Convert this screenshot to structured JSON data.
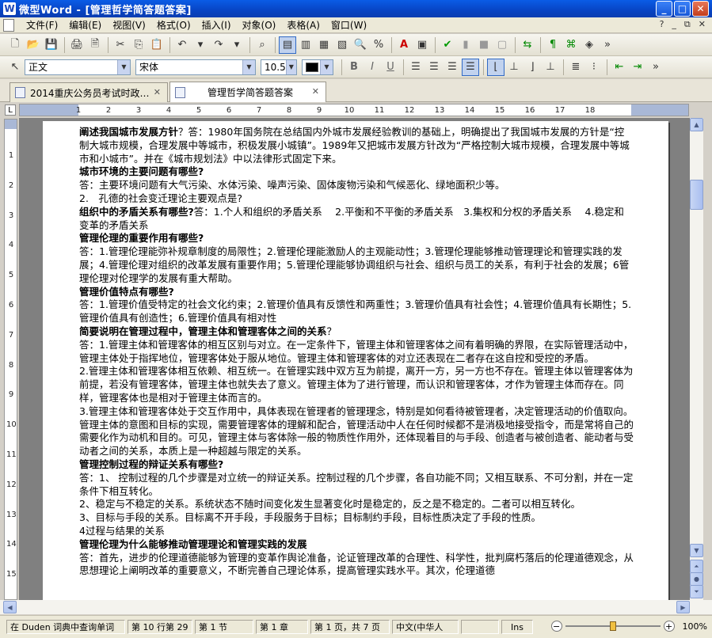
{
  "window": {
    "app_icon": "W",
    "title": "微型Word - [管理哲学简答题答案]",
    "controls": [
      "_",
      "□",
      "✕"
    ]
  },
  "menu": {
    "items": [
      "文件(F)",
      "编辑(E)",
      "视图(V)",
      "格式(O)",
      "插入(I)",
      "对象(O)",
      "表格(A)",
      "窗口(W)"
    ],
    "right_controls": [
      "?",
      "_",
      "⧉",
      "✕"
    ]
  },
  "toolbar2": {
    "style": "正文",
    "font": "宋体",
    "size": "10.5"
  },
  "tabs": [
    {
      "label": "2014重庆公务员考试时政…"
    },
    {
      "label": "管理哲学简答题答案"
    }
  ],
  "ruler": {
    "ticks": [
      "1",
      "2",
      "3",
      "4",
      "5",
      "6",
      "7",
      "8",
      "9",
      "10",
      "11",
      "12",
      "13",
      "14",
      "15",
      "16",
      "17",
      "18"
    ]
  },
  "vruler": {
    "ticks": [
      "1",
      "2",
      "3",
      "4",
      "5",
      "6",
      "7",
      "8",
      "9",
      "10",
      "11",
      "12",
      "13",
      "14",
      "15",
      "16"
    ]
  },
  "document": {
    "paragraphs": [
      {
        "bold": "阐述我国城市发展方针",
        "text": "？答：1980年国务院在总结国内外城市发展经验教训的基础上，明确提出了我国城市发展的方针是“控制大城市规模，合理发展中等城市，积极发展小城镇”。1989年又把城市发展方针改为“严格控制大城市规模，合理发展中等城市和小城市”。并在《城市规划法》中以法律形式固定下来。"
      },
      {
        "bold": "城市环境的主要问题有哪些?",
        "text": ""
      },
      {
        "bold": "",
        "text": "答：主要环境问题有大气污染、水体污染、噪声污染、固体废物污染和气候恶化、绿地面积少等。"
      },
      {
        "bold": "",
        "text": "2.　孔德的社会变迁理论主要观点是?"
      },
      {
        "bold": "组织中的矛盾关系有哪些?",
        "text": "答：1.个人和组织的矛盾关系　 2.平衡和不平衡的矛盾关系　3.集权和分权的矛盾关系　 4.稳定和变革的矛盾关系"
      },
      {
        "bold": "管理伦理的重要作用有哪些?",
        "text": ""
      },
      {
        "bold": "",
        "text": "答：1.管理伦理能弥补规章制度的局限性；2.管理伦理能激励人的主观能动性；3.管理伦理能够推动管理理论和管理实践的发展；4.管理伦理对组织的改革发展有重要作用；5.管理伦理能够协调组织与社会、组织与员工的关系，有利于社会的发展；6管理伦理对伦理学的发展有重大帮助。"
      },
      {
        "bold": "管理价值特点有哪些?",
        "text": ""
      },
      {
        "bold": "",
        "text": "答：1.管理价值受特定的社会文化约束；2.管理价值具有反馈性和两重性；3.管理价值具有社会性；4.管理价值具有长期性；5.管理价值具有创造性；6.管理价值具有相对性"
      },
      {
        "bold": "简要说明在管理过程中，管理主体和管理客体之间的关系",
        "text": "？"
      },
      {
        "bold": "",
        "text": "答：1.管理主体和管理客体的相互区别与对立。在一定条件下，管理主体和管理客体之间有着明确的界限，在实际管理活动中，管理主体处于指挥地位，管理客体处于服从地位。管理主体和管理客体的对立还表现在二者存在这自控和受控的矛盾。"
      },
      {
        "bold": "",
        "text": "2.管理主体和管理客体相互依赖、相互统一。在管理实践中双方互为前提，离开一方，另一方也不存在。管理主体以管理客体为前提，若没有管理客体，管理主体也就失去了意义。管理主体为了进行管理，而认识和管理客体，才作为管理主体而存在。同样，管理客体也是相对于管理主体而言的。"
      },
      {
        "bold": "",
        "text": "3.管理主体和管理客体处于交互作用中，具体表现在管理者的管理理念，特别是如何看待被管理者，决定管理活动的价值取向。管理主体的意图和目标的实现，需要管理客体的理解和配合，管理活动中人在任何时候都不是消极地接受指令，而是常将自己的需要化作为动机和目的。可见，管理主体与客体除一般的物质性作用外，还体现着目的与手段、创造者与被创造者、能动者与受动者之间的关系，本质上是一种超越与限定的关系。"
      },
      {
        "bold": "管理控制过程的辩证关系有哪些?",
        "text": ""
      },
      {
        "bold": "",
        "text": "答：1、 控制过程的几个步骤是对立统一的辩证关系。控制过程的几个步骤，各自功能不同；又相互联系、不可分割，并在一定条件下相互转化。"
      },
      {
        "bold": "",
        "text": "2、稳定与不稳定的关系。系统状态不随时间变化发生显著变化时是稳定的，反之是不稳定的。二者可以相互转化。"
      },
      {
        "bold": "",
        "text": "3、目标与手段的关系。目标离不开手段，手段服务于目标；目标制约手段，目标性质决定了手段的性质。"
      },
      {
        "bold": "",
        "text": "4过程与结果的关系"
      },
      {
        "bold": "管理伦理为什么能够推动管理理论和管理实践的发展",
        "text": ""
      },
      {
        "bold": "",
        "text": "答：首先，进步的伦理道德能够为管理的变革作舆论准备，论证管理改革的合理性、科学性，批判腐朽落后的伦理道德观念，从思想理论上阐明改革的重要意义，不断完善自己理论体系，提高管理实践水平。其次，伦理道德"
      }
    ]
  },
  "statusbar": {
    "cells": [
      "在 Duden 词典中查询单词",
      "第 10 行第 29",
      "第 1 节",
      "第 1 章",
      "第 1 页，共 7 页",
      "中文(中华人",
      "",
      "Ins"
    ],
    "zoom": "100%"
  }
}
